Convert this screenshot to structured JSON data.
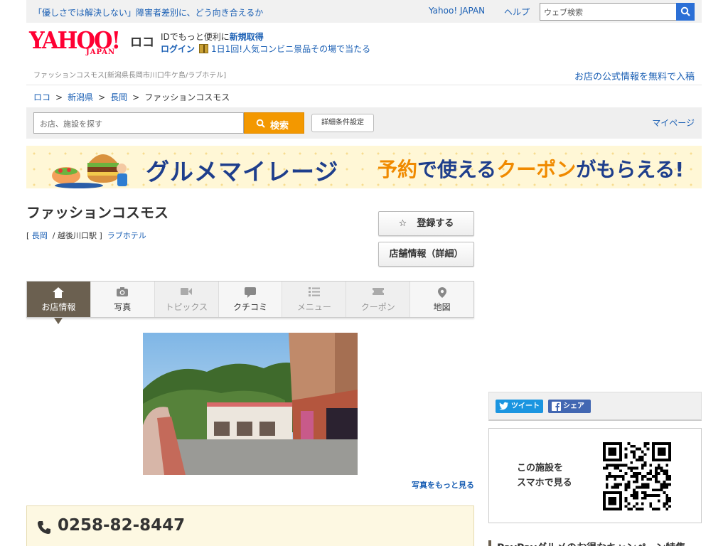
{
  "topbar": {
    "notice": "「優しさでは解決しない」障害者差別に、どう向き合えるか",
    "yahoo_japan": "Yahoo! JAPAN",
    "help": "ヘルプ",
    "search_placeholder": "ウェブ検索"
  },
  "header": {
    "logo_text": "YAHOO!",
    "logo_sub": "JAPAN",
    "service": "ロコ",
    "id_text": "IDでもっと便利に",
    "register": "新規取得",
    "login": "ログイン",
    "promo": "1日1回!人気コンビニ景品その場で当たる",
    "small_crumb": "ファッションコスモス[新潟県長岡市川口牛ケ島/ラブホテル]",
    "free_post": "お店の公式情報を無料で入稿"
  },
  "breadcrumb": [
    "ロコ",
    "新潟県",
    "長岡",
    "ファッションコスモス"
  ],
  "searchbar": {
    "placeholder": "お店、施設を探す",
    "button": "検索",
    "advanced": "詳細条件設定",
    "mypage": "マイページ"
  },
  "banner": {
    "title": "グルメマイレージ",
    "part1": "予約",
    "part2": "で使える",
    "part3": "クーポン",
    "part4": "がもらえる!"
  },
  "shop": {
    "name": "ファッションコスモス",
    "area": "長岡",
    "station": "/ 越後川口駅",
    "category": "ラブホテル",
    "register_btn": "登録する",
    "info_btn": "店舗情報（詳細）",
    "more_photos": "写真をもっと見る",
    "phone": "0258-82-8447"
  },
  "tabs": [
    {
      "label": "お店情報",
      "icon": "home-icon",
      "state": "active"
    },
    {
      "label": "写真",
      "icon": "camera-icon",
      "state": "normal"
    },
    {
      "label": "トピックス",
      "icon": "video-icon",
      "state": "disabled"
    },
    {
      "label": "クチコミ",
      "icon": "comment-icon",
      "state": "normal"
    },
    {
      "label": "メニュー",
      "icon": "list-icon",
      "state": "disabled"
    },
    {
      "label": "クーポン",
      "icon": "ticket-icon",
      "state": "disabled"
    },
    {
      "label": "地図",
      "icon": "map-pin-icon",
      "state": "normal"
    }
  ],
  "side": {
    "tweet": "ツイート",
    "share": "シェア",
    "qr_text_1": "この施設を",
    "qr_text_2": "スマホで見る",
    "campaign": "PayPayグルメのお得なキャンペーン特集"
  },
  "colors": {
    "link": "#1a5fb4",
    "accent": "#f39800",
    "yahoo_red": "#ff0033",
    "tab_active": "#6b6050"
  }
}
